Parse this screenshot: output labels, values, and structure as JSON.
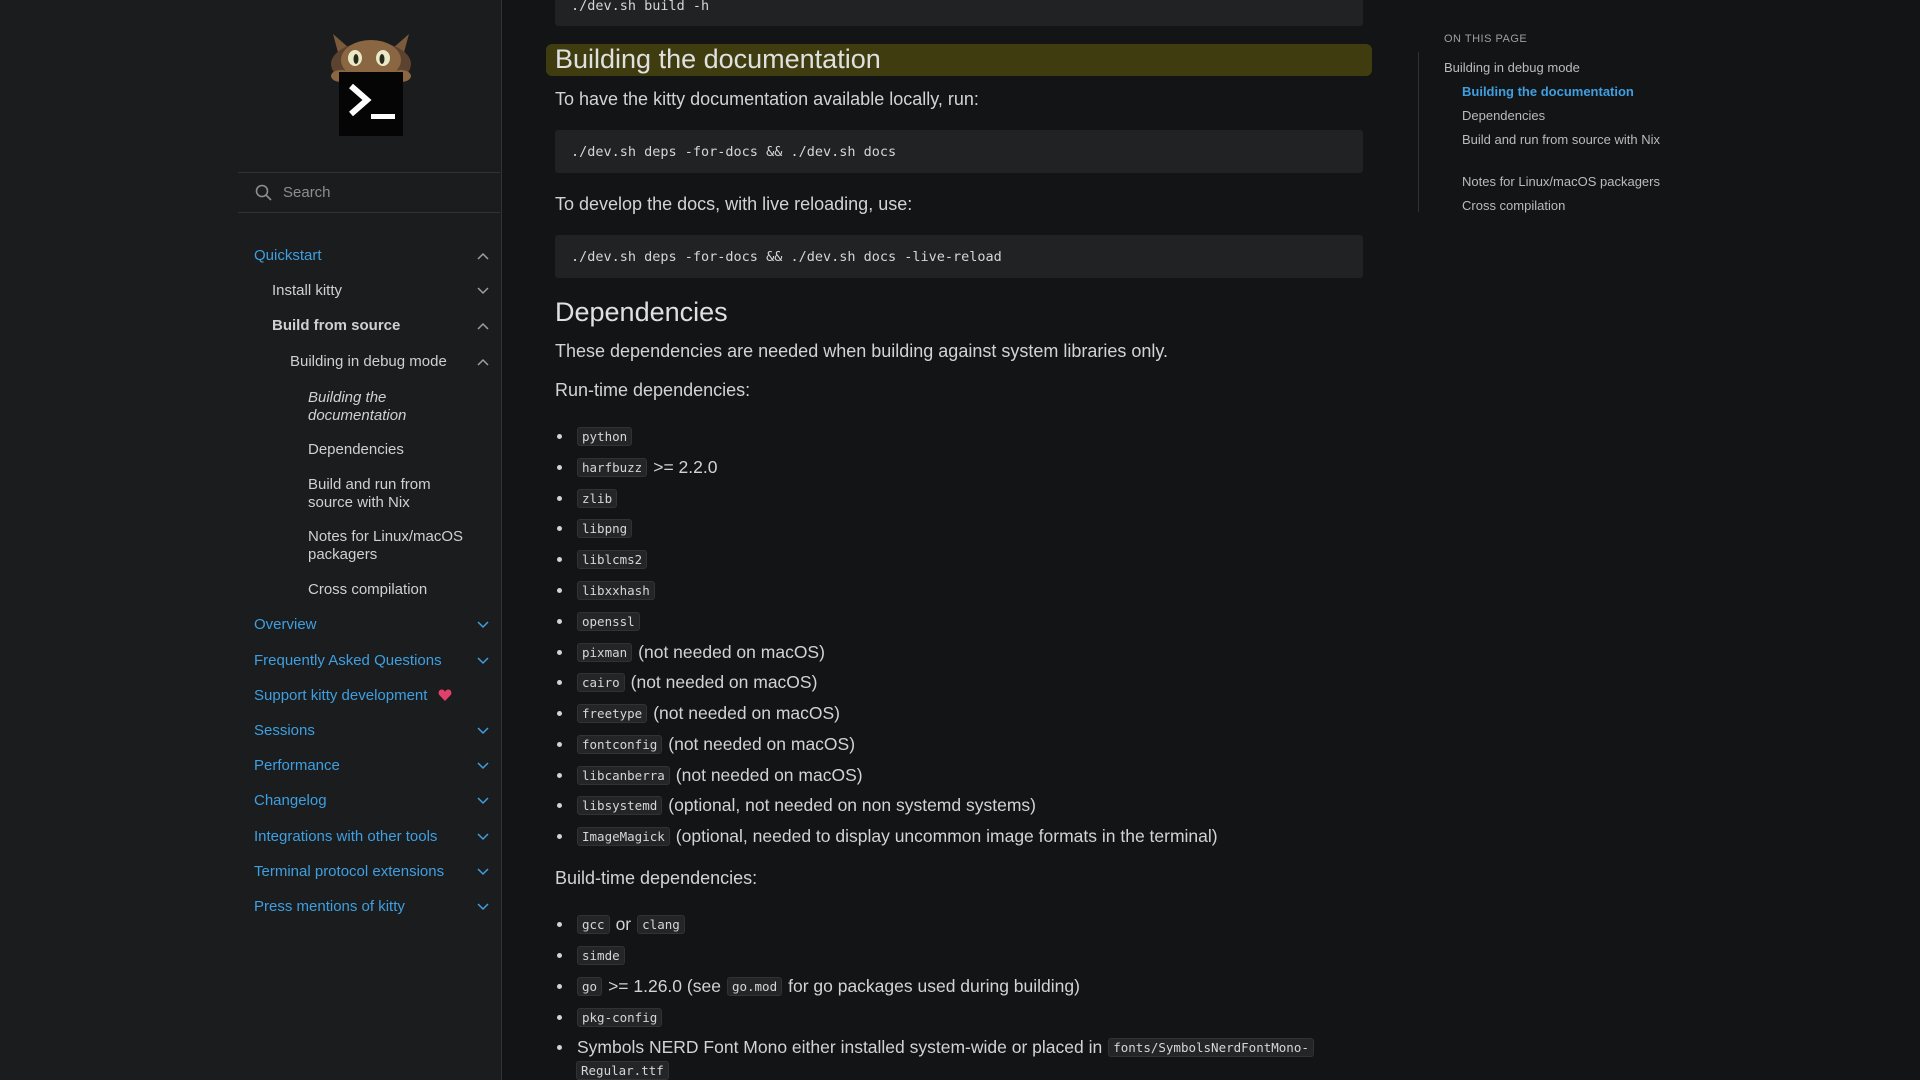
{
  "sidebar": {
    "search_placeholder": "Search",
    "nav": [
      {
        "label": "Quickstart"
      },
      {
        "label": "Install kitty"
      },
      {
        "label": "Build from source"
      },
      {
        "label": "Building in debug mode"
      },
      {
        "label": "Building the documentation"
      },
      {
        "label": "Dependencies"
      },
      {
        "label": "Build and run from source with Nix"
      },
      {
        "label": "Notes for Linux/macOS packagers"
      },
      {
        "label": "Cross compilation"
      },
      {
        "label": "Overview"
      },
      {
        "label": "Frequently Asked Questions"
      },
      {
        "label": "Support kitty development"
      },
      {
        "label": "Sessions"
      },
      {
        "label": "Performance"
      },
      {
        "label": "Changelog"
      },
      {
        "label": "Integrations with other tools"
      },
      {
        "label": "Terminal protocol extensions"
      },
      {
        "label": "Press mentions of kitty"
      }
    ],
    "colors": {
      "link": "#3f9fe0",
      "heart": "#e0406a"
    }
  },
  "main": {
    "top_code": "./dev.sh build -h",
    "section1": {
      "title": "Building the documentation",
      "intro": "To have the kitty documentation available locally, run:",
      "code1": "./dev.sh deps -for-docs && ./dev.sh docs",
      "para2": "To develop the docs, with live reloading, use:",
      "code2": "./dev.sh deps -for-docs && ./dev.sh docs -live-reload"
    },
    "section2": {
      "title": "Dependencies",
      "intro": "These dependencies are needed when building against system libraries only.",
      "runtime_label": "Run-time dependencies:",
      "runtime": [
        {
          "code": "python",
          "note": ""
        },
        {
          "code": "harfbuzz",
          "note": ">= 2.2.0"
        },
        {
          "code": "zlib",
          "note": ""
        },
        {
          "code": "libpng",
          "note": ""
        },
        {
          "code": "liblcms2",
          "note": ""
        },
        {
          "code": "libxxhash",
          "note": ""
        },
        {
          "code": "openssl",
          "note": ""
        },
        {
          "code": "pixman",
          "note": "(not needed on macOS)"
        },
        {
          "code": "cairo",
          "note": "(not needed on macOS)"
        },
        {
          "code": "freetype",
          "note": "(not needed on macOS)"
        },
        {
          "code": "fontconfig",
          "note": "(not needed on macOS)"
        },
        {
          "code": "libcanberra",
          "note": "(not needed on macOS)"
        },
        {
          "code": "libsystemd",
          "note": "(optional, not needed on non systemd systems)"
        },
        {
          "code": "ImageMagick",
          "note": "(optional, needed to display uncommon image formats in the terminal)"
        }
      ],
      "buildtime_label": "Build-time dependencies:",
      "buildtime": {
        "gcc": "gcc",
        "or": "or",
        "clang": "clang",
        "simde": "simde",
        "go": "go",
        "go_note_a": ">= 1.26.0 (see",
        "go_mod": "go.mod",
        "go_note_b": "for go packages used during building)",
        "pkgconfig": "pkg-config",
        "nerd_text": "Symbols NERD Font Mono either installed system-wide or placed in",
        "nerd_path_a": "fonts/SymbolsNerdFontMono-",
        "nerd_path_b": "Regular.ttf"
      }
    },
    "highlight_color": "#3f3d10"
  },
  "toc": {
    "title": "ON THIS PAGE",
    "items": [
      {
        "label": "Building in debug mode"
      },
      {
        "label": "Building the documentation"
      },
      {
        "label": "Dependencies"
      },
      {
        "label": "Build and run from source with Nix"
      },
      {
        "label": "Notes for Linux/macOS packagers"
      },
      {
        "label": "Cross compilation"
      }
    ]
  }
}
